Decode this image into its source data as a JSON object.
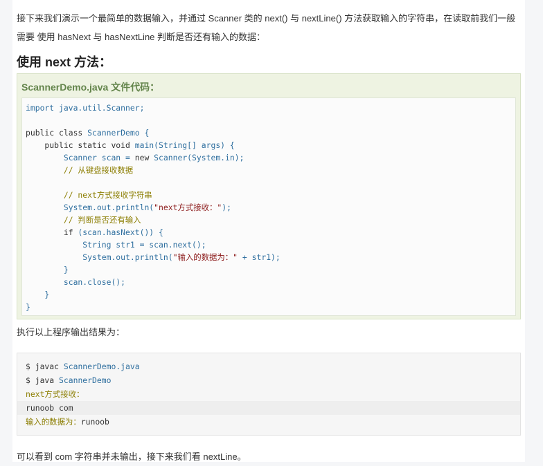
{
  "intro_text": "接下来我们演示一个最简单的数据输入，并通过 Scanner 类的 next() 与 nextLine() 方法获取输入的字符串，在读取前我们一般需要 使用 hasNext 与 hasNextLine 判断是否还有输入的数据：",
  "heading": "使用 next 方法：",
  "example": {
    "title": "ScannerDemo.java 文件代码：",
    "code_lines": [
      [
        {
          "t": "import java.util.Scanner;",
          "c": "pl"
        }
      ],
      [],
      [
        {
          "t": "public class ",
          "c": "kw"
        },
        {
          "t": "ScannerDemo {",
          "c": "pl"
        }
      ],
      [
        {
          "t": "    public static void ",
          "c": "kw"
        },
        {
          "t": "main(String[] args) {",
          "c": "pl"
        }
      ],
      [
        {
          "t": "        Scanner scan = ",
          "c": "pl"
        },
        {
          "t": "new ",
          "c": "kw"
        },
        {
          "t": "Scanner(System.in);",
          "c": "pl"
        }
      ],
      [
        {
          "t": "        // 从键盘接收数据",
          "c": "cm"
        }
      ],
      [],
      [
        {
          "t": "        // next方式接收字符串",
          "c": "cm"
        }
      ],
      [
        {
          "t": "        System.out.println(",
          "c": "pl"
        },
        {
          "t": "\"next方式接收：\"",
          "c": "st"
        },
        {
          "t": ");",
          "c": "pl"
        }
      ],
      [
        {
          "t": "        // 判断是否还有输入",
          "c": "cm"
        }
      ],
      [
        {
          "t": "        if ",
          "c": "kw"
        },
        {
          "t": "(scan.hasNext()) {",
          "c": "pl"
        }
      ],
      [
        {
          "t": "            String str1 = scan.next();",
          "c": "pl"
        }
      ],
      [
        {
          "t": "            System.out.println(",
          "c": "pl"
        },
        {
          "t": "\"输入的数据为：\"",
          "c": "st"
        },
        {
          "t": " + str1);",
          "c": "pl"
        }
      ],
      [
        {
          "t": "        }",
          "c": "pl"
        }
      ],
      [
        {
          "t": "        scan.close();",
          "c": "pl"
        }
      ],
      [
        {
          "t": "    }",
          "c": "pl"
        }
      ],
      [
        {
          "t": "}",
          "c": "pl"
        }
      ]
    ]
  },
  "output_label": "执行以上程序输出结果为：",
  "terminal_lines": [
    [
      {
        "t": "$ javac ",
        "c": "cmd"
      },
      {
        "t": "ScannerDemo.java",
        "c": "arg"
      }
    ],
    [
      {
        "t": "$ java ",
        "c": "cmd"
      },
      {
        "t": "ScannerDemo",
        "c": "arg"
      }
    ],
    [
      {
        "t": "next方式接收：",
        "c": "yl"
      }
    ],
    [
      {
        "t": "runoob com",
        "c": "cmd"
      }
    ],
    [
      {
        "t": "输入的数据为：",
        "c": "yl"
      },
      {
        "t": "runoob",
        "c": "cmd"
      }
    ]
  ],
  "outro_text": "可以看到 com 字符串并未输出，接下来我们看 nextLine。"
}
